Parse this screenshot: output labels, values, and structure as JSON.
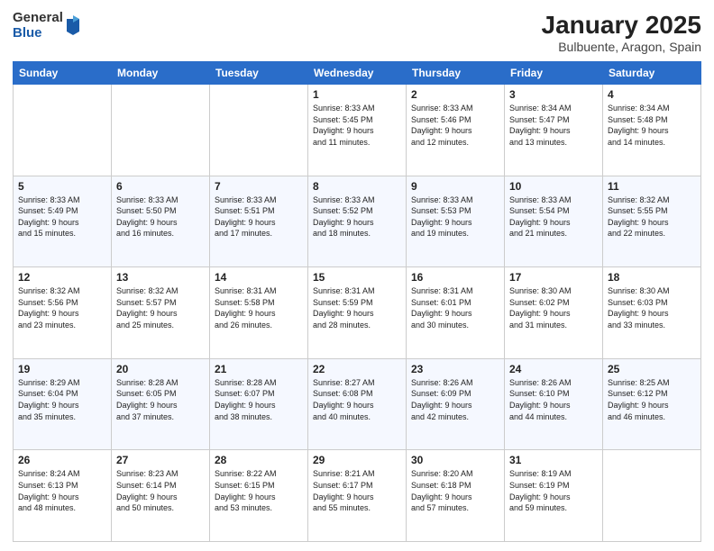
{
  "header": {
    "logo_general": "General",
    "logo_blue": "Blue",
    "month_title": "January 2025",
    "subtitle": "Bulbuente, Aragon, Spain"
  },
  "days_of_week": [
    "Sunday",
    "Monday",
    "Tuesday",
    "Wednesday",
    "Thursday",
    "Friday",
    "Saturday"
  ],
  "weeks": [
    {
      "cells": [
        {
          "day": null,
          "text": null
        },
        {
          "day": null,
          "text": null
        },
        {
          "day": null,
          "text": null
        },
        {
          "day": "1",
          "text": "Sunrise: 8:33 AM\nSunset: 5:45 PM\nDaylight: 9 hours\nand 11 minutes."
        },
        {
          "day": "2",
          "text": "Sunrise: 8:33 AM\nSunset: 5:46 PM\nDaylight: 9 hours\nand 12 minutes."
        },
        {
          "day": "3",
          "text": "Sunrise: 8:34 AM\nSunset: 5:47 PM\nDaylight: 9 hours\nand 13 minutes."
        },
        {
          "day": "4",
          "text": "Sunrise: 8:34 AM\nSunset: 5:48 PM\nDaylight: 9 hours\nand 14 minutes."
        }
      ]
    },
    {
      "cells": [
        {
          "day": "5",
          "text": "Sunrise: 8:33 AM\nSunset: 5:49 PM\nDaylight: 9 hours\nand 15 minutes."
        },
        {
          "day": "6",
          "text": "Sunrise: 8:33 AM\nSunset: 5:50 PM\nDaylight: 9 hours\nand 16 minutes."
        },
        {
          "day": "7",
          "text": "Sunrise: 8:33 AM\nSunset: 5:51 PM\nDaylight: 9 hours\nand 17 minutes."
        },
        {
          "day": "8",
          "text": "Sunrise: 8:33 AM\nSunset: 5:52 PM\nDaylight: 9 hours\nand 18 minutes."
        },
        {
          "day": "9",
          "text": "Sunrise: 8:33 AM\nSunset: 5:53 PM\nDaylight: 9 hours\nand 19 minutes."
        },
        {
          "day": "10",
          "text": "Sunrise: 8:33 AM\nSunset: 5:54 PM\nDaylight: 9 hours\nand 21 minutes."
        },
        {
          "day": "11",
          "text": "Sunrise: 8:32 AM\nSunset: 5:55 PM\nDaylight: 9 hours\nand 22 minutes."
        }
      ]
    },
    {
      "cells": [
        {
          "day": "12",
          "text": "Sunrise: 8:32 AM\nSunset: 5:56 PM\nDaylight: 9 hours\nand 23 minutes."
        },
        {
          "day": "13",
          "text": "Sunrise: 8:32 AM\nSunset: 5:57 PM\nDaylight: 9 hours\nand 25 minutes."
        },
        {
          "day": "14",
          "text": "Sunrise: 8:31 AM\nSunset: 5:58 PM\nDaylight: 9 hours\nand 26 minutes."
        },
        {
          "day": "15",
          "text": "Sunrise: 8:31 AM\nSunset: 5:59 PM\nDaylight: 9 hours\nand 28 minutes."
        },
        {
          "day": "16",
          "text": "Sunrise: 8:31 AM\nSunset: 6:01 PM\nDaylight: 9 hours\nand 30 minutes."
        },
        {
          "day": "17",
          "text": "Sunrise: 8:30 AM\nSunset: 6:02 PM\nDaylight: 9 hours\nand 31 minutes."
        },
        {
          "day": "18",
          "text": "Sunrise: 8:30 AM\nSunset: 6:03 PM\nDaylight: 9 hours\nand 33 minutes."
        }
      ]
    },
    {
      "cells": [
        {
          "day": "19",
          "text": "Sunrise: 8:29 AM\nSunset: 6:04 PM\nDaylight: 9 hours\nand 35 minutes."
        },
        {
          "day": "20",
          "text": "Sunrise: 8:28 AM\nSunset: 6:05 PM\nDaylight: 9 hours\nand 37 minutes."
        },
        {
          "day": "21",
          "text": "Sunrise: 8:28 AM\nSunset: 6:07 PM\nDaylight: 9 hours\nand 38 minutes."
        },
        {
          "day": "22",
          "text": "Sunrise: 8:27 AM\nSunset: 6:08 PM\nDaylight: 9 hours\nand 40 minutes."
        },
        {
          "day": "23",
          "text": "Sunrise: 8:26 AM\nSunset: 6:09 PM\nDaylight: 9 hours\nand 42 minutes."
        },
        {
          "day": "24",
          "text": "Sunrise: 8:26 AM\nSunset: 6:10 PM\nDaylight: 9 hours\nand 44 minutes."
        },
        {
          "day": "25",
          "text": "Sunrise: 8:25 AM\nSunset: 6:12 PM\nDaylight: 9 hours\nand 46 minutes."
        }
      ]
    },
    {
      "cells": [
        {
          "day": "26",
          "text": "Sunrise: 8:24 AM\nSunset: 6:13 PM\nDaylight: 9 hours\nand 48 minutes."
        },
        {
          "day": "27",
          "text": "Sunrise: 8:23 AM\nSunset: 6:14 PM\nDaylight: 9 hours\nand 50 minutes."
        },
        {
          "day": "28",
          "text": "Sunrise: 8:22 AM\nSunset: 6:15 PM\nDaylight: 9 hours\nand 53 minutes."
        },
        {
          "day": "29",
          "text": "Sunrise: 8:21 AM\nSunset: 6:17 PM\nDaylight: 9 hours\nand 55 minutes."
        },
        {
          "day": "30",
          "text": "Sunrise: 8:20 AM\nSunset: 6:18 PM\nDaylight: 9 hours\nand 57 minutes."
        },
        {
          "day": "31",
          "text": "Sunrise: 8:19 AM\nSunset: 6:19 PM\nDaylight: 9 hours\nand 59 minutes."
        },
        {
          "day": null,
          "text": null
        }
      ]
    }
  ]
}
